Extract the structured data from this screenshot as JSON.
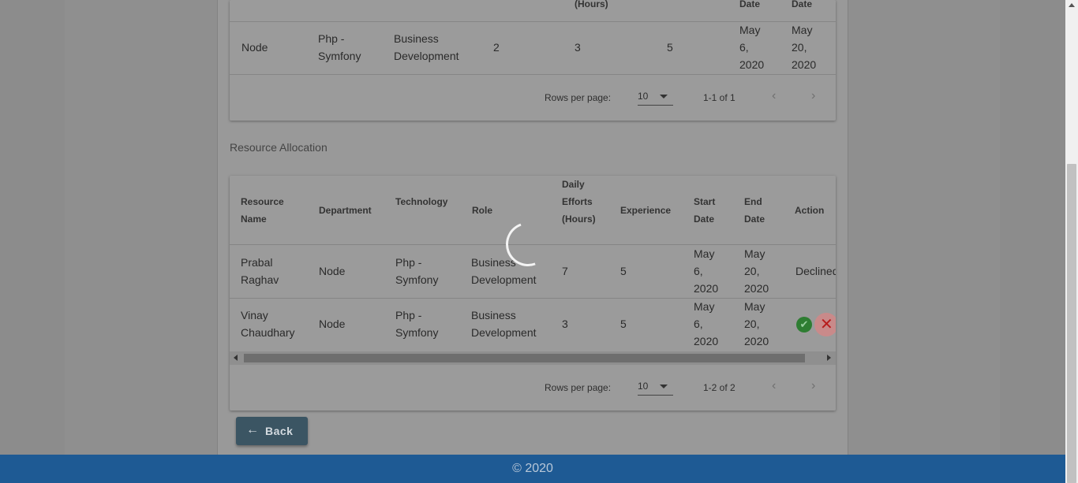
{
  "top_table": {
    "header_partial": [
      "(Hours)",
      "Date",
      "Date"
    ],
    "row": [
      "Node",
      "Php - Symfony",
      "Business Development",
      "2",
      "3",
      "5",
      "May 6, 2020",
      "May 20, 2020"
    ],
    "pagination": {
      "rows_per_page_label": "Rows per page:",
      "rows_per_page_value": "10",
      "range": "1-1 of 1",
      "prev": "‹",
      "next": "›"
    }
  },
  "resource_allocation": {
    "title": "Resource Allocation",
    "headers": [
      "Resource Name",
      "Department",
      "Technology",
      "Role",
      "Daily Efforts (Hours)",
      "Experience",
      "Start Date",
      "End Date",
      "Action"
    ],
    "rows": [
      {
        "name": "Prabal Raghav",
        "department": "Node",
        "technology": "Php - Symfony",
        "role": "Business Development",
        "efforts": "7",
        "experience": "5",
        "start": "May 6, 2020",
        "end": "May 20, 2020",
        "action": "Declined"
      },
      {
        "name": "Vinay Chaudhary",
        "department": "Node",
        "technology": "Php - Symfony",
        "role": "Business Development",
        "efforts": "3",
        "experience": "5",
        "start": "May 6, 2020",
        "end": "May 20, 2020",
        "action": ""
      }
    ],
    "pagination": {
      "rows_per_page_label": "Rows per page:",
      "rows_per_page_value": "10",
      "range": "1-2 of 2",
      "prev": "‹",
      "next": "›"
    }
  },
  "icons": {
    "approve": "check-circle-icon",
    "reject": "close-icon",
    "back": "arrow-left-icon"
  },
  "back_button": {
    "label": "Back"
  },
  "footer": {
    "text": "© 2020"
  },
  "colors": {
    "footer": "#1e5a94",
    "back_button": "#3b5563",
    "approve": "#2e7d32",
    "reject": "#b71c1c"
  }
}
